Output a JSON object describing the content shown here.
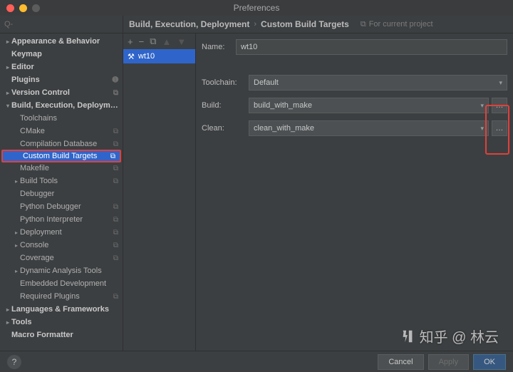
{
  "window": {
    "title": "Preferences"
  },
  "search": {
    "placeholder": "Q-"
  },
  "sidebar": {
    "items": [
      {
        "label": "Appearance & Behavior",
        "level": 0,
        "chev": "▸",
        "icon": ""
      },
      {
        "label": "Keymap",
        "level": 0,
        "chev": "",
        "icon": ""
      },
      {
        "label": "Editor",
        "level": 0,
        "chev": "▸",
        "icon": ""
      },
      {
        "label": "Plugins",
        "level": 0,
        "chev": "",
        "icon": "➊"
      },
      {
        "label": "Version Control",
        "level": 0,
        "chev": "▸",
        "icon": "⧉"
      },
      {
        "label": "Build, Execution, Deployment",
        "level": 0,
        "chev": "▾",
        "icon": ""
      },
      {
        "label": "Toolchains",
        "level": 1,
        "chev": "",
        "icon": ""
      },
      {
        "label": "CMake",
        "level": 1,
        "chev": "",
        "icon": "⧉"
      },
      {
        "label": "Compilation Database",
        "level": 1,
        "chev": "",
        "icon": "⧉"
      },
      {
        "label": "Custom Build Targets",
        "level": 1,
        "chev": "",
        "icon": "⧉",
        "selected": true,
        "boxed": true
      },
      {
        "label": "Makefile",
        "level": 1,
        "chev": "",
        "icon": "⧉"
      },
      {
        "label": "Build Tools",
        "level": 1,
        "chev": "▸",
        "icon": "⧉"
      },
      {
        "label": "Debugger",
        "level": 1,
        "chev": "",
        "icon": ""
      },
      {
        "label": "Python Debugger",
        "level": 1,
        "chev": "",
        "icon": "⧉"
      },
      {
        "label": "Python Interpreter",
        "level": 1,
        "chev": "",
        "icon": "⧉"
      },
      {
        "label": "Deployment",
        "level": 1,
        "chev": "▸",
        "icon": "⧉"
      },
      {
        "label": "Console",
        "level": 1,
        "chev": "▸",
        "icon": "⧉"
      },
      {
        "label": "Coverage",
        "level": 1,
        "chev": "",
        "icon": "⧉"
      },
      {
        "label": "Dynamic Analysis Tools",
        "level": 1,
        "chev": "▸",
        "icon": ""
      },
      {
        "label": "Embedded Development",
        "level": 1,
        "chev": "",
        "icon": ""
      },
      {
        "label": "Required Plugins",
        "level": 1,
        "chev": "",
        "icon": "⧉"
      },
      {
        "label": "Languages & Frameworks",
        "level": 0,
        "chev": "▸",
        "icon": ""
      },
      {
        "label": "Tools",
        "level": 0,
        "chev": "▸",
        "icon": ""
      },
      {
        "label": "Macro Formatter",
        "level": 0,
        "chev": "",
        "icon": ""
      }
    ]
  },
  "breadcrumb": {
    "a": "Build, Execution, Deployment",
    "b": "Custom Build Targets",
    "tag": "For current project"
  },
  "targets": {
    "toolbar": {
      "add": "+",
      "remove": "−",
      "copy": "⧉",
      "up": "",
      "down": ""
    },
    "items": [
      {
        "name": "wt10"
      }
    ]
  },
  "form": {
    "name_label": "Name:",
    "name_value": "wt10",
    "toolchain_label": "Toolchain:",
    "toolchain_value": "Default",
    "build_label": "Build:",
    "build_value": "build_with_make",
    "clean_label": "Clean:",
    "clean_value": "clean_with_make",
    "browse": "…"
  },
  "footer": {
    "help": "?",
    "cancel": "Cancel",
    "apply": "Apply",
    "ok": "OK"
  },
  "watermark": "知乎 @ 林云"
}
